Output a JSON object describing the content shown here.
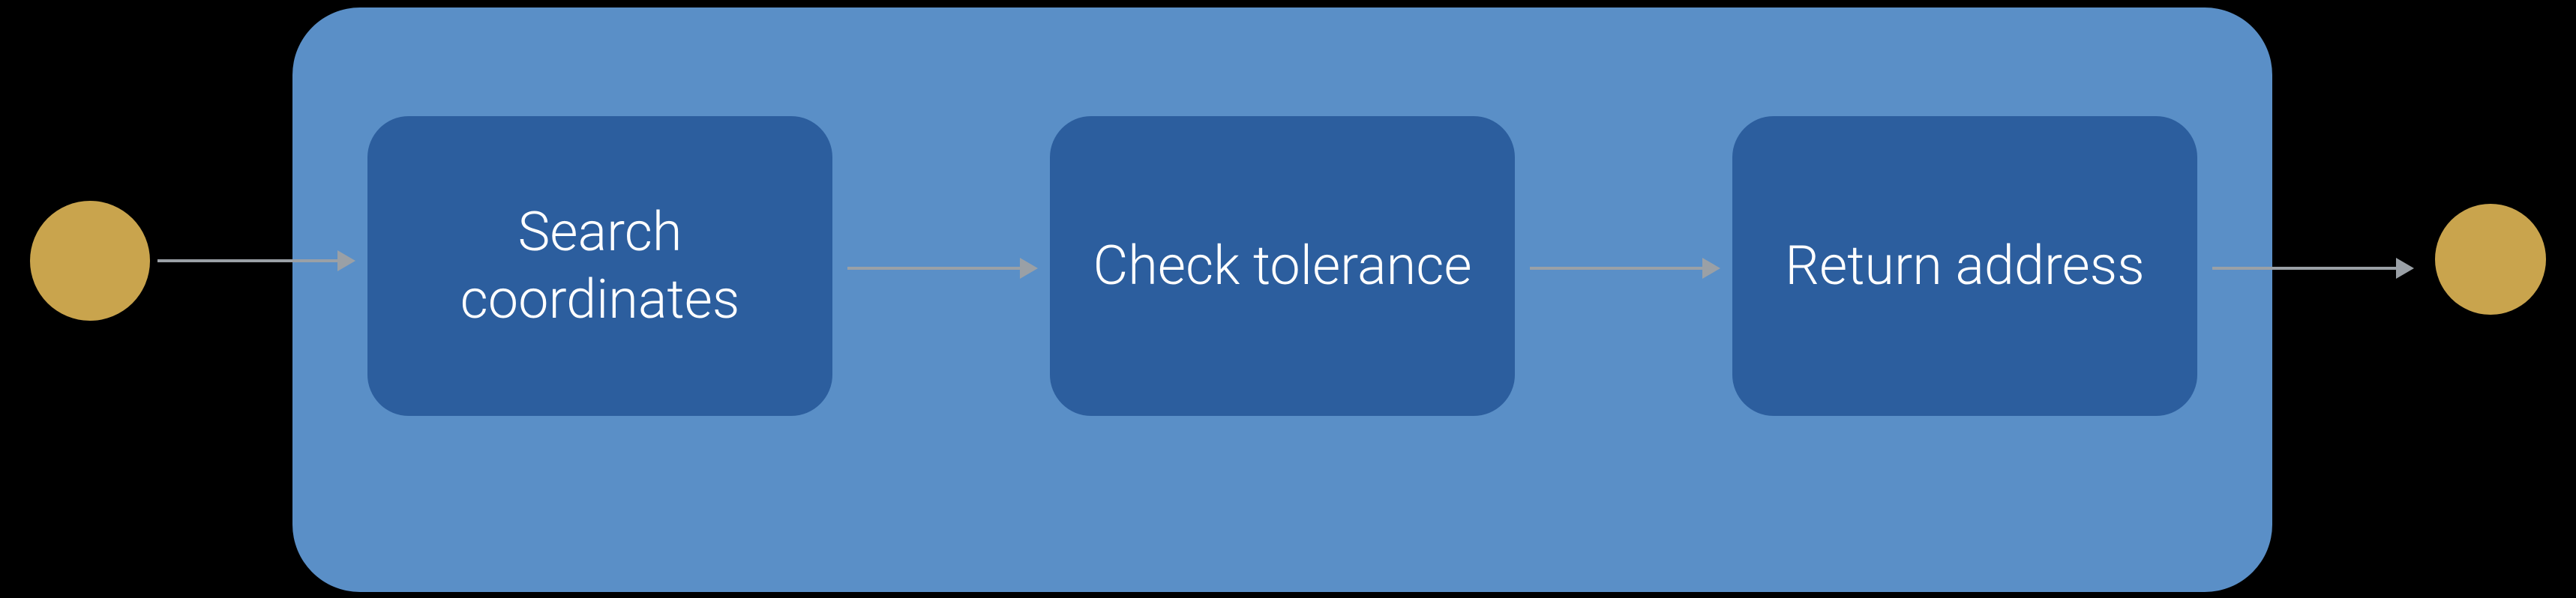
{
  "diagram": {
    "steps": [
      {
        "label": "Search coordinates"
      },
      {
        "label": "Check tolerance"
      },
      {
        "label": "Return address"
      }
    ]
  }
}
